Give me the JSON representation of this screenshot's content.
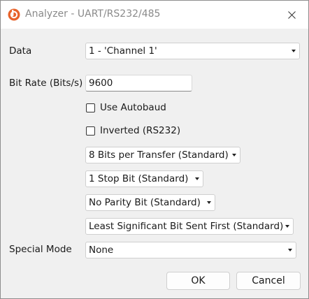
{
  "window": {
    "title": "Analyzer - UART/RS232/485",
    "icon": "analyzer-logo-icon",
    "close_icon": "close-icon",
    "accent_color": "#e8632b"
  },
  "form": {
    "data_label": "Data",
    "data_value": "1 - 'Channel 1'",
    "bitrate_label": "Bit Rate (Bits/s)",
    "bitrate_value": "9600",
    "autobaud_label": "Use Autobaud",
    "autobaud_checked": false,
    "inverted_label": "Inverted (RS232)",
    "inverted_checked": false,
    "bits_per_transfer": "8 Bits per Transfer (Standard)",
    "stop_bits": "1 Stop Bit (Standard)",
    "parity": "No Parity Bit (Standard)",
    "bit_order": "Least Significant Bit Sent First (Standard)",
    "special_mode_label": "Special Mode",
    "special_mode_value": "None"
  },
  "buttons": {
    "ok_label": "OK",
    "cancel_label": "Cancel"
  }
}
